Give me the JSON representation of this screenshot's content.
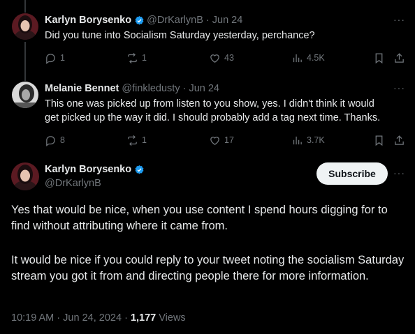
{
  "tweet1": {
    "name": "Karlyn Borysenko",
    "handle": "@DrKarlynB",
    "date": "Jun 24",
    "text": "Did you tune into Socialism Saturday yesterday, perchance?",
    "replies": "1",
    "reposts": "1",
    "likes": "43",
    "views": "4.5K"
  },
  "tweet2": {
    "name": "Melanie Bennet",
    "handle": "@finkledusty",
    "date": "Jun 24",
    "text_line1": "This one was picked up from listen to you show, yes. I didn't think it would",
    "text_line2": "get picked up the way it did. I should probably add a tag next time. Thanks.",
    "replies": "8",
    "reposts": "1",
    "likes": "17",
    "views": "3.7K"
  },
  "main": {
    "name": "Karlyn Borysenko",
    "handle": "@DrKarlynB",
    "subscribe_label": "Subscribe",
    "para1": "Yes that would be nice, when you use content I spend hours digging for to find without attributing where it came from.",
    "para2": "It would be nice if you could reply to your tweet noting the socialism Saturday stream you got it from and directing people there for more information.",
    "time": "10:19 AM",
    "date": "Jun 24, 2024",
    "views_count": "1,177",
    "views_label": "Views"
  },
  "separator": "·",
  "colors": {
    "verified": "#1d9bf0",
    "muted": "#71767b",
    "text": "#e7e9ea",
    "background": "#000000"
  },
  "icons": [
    "reply-icon",
    "repost-icon",
    "like-icon",
    "views-icon",
    "bookmark-icon",
    "share-icon",
    "more-icon",
    "verified-icon"
  ]
}
